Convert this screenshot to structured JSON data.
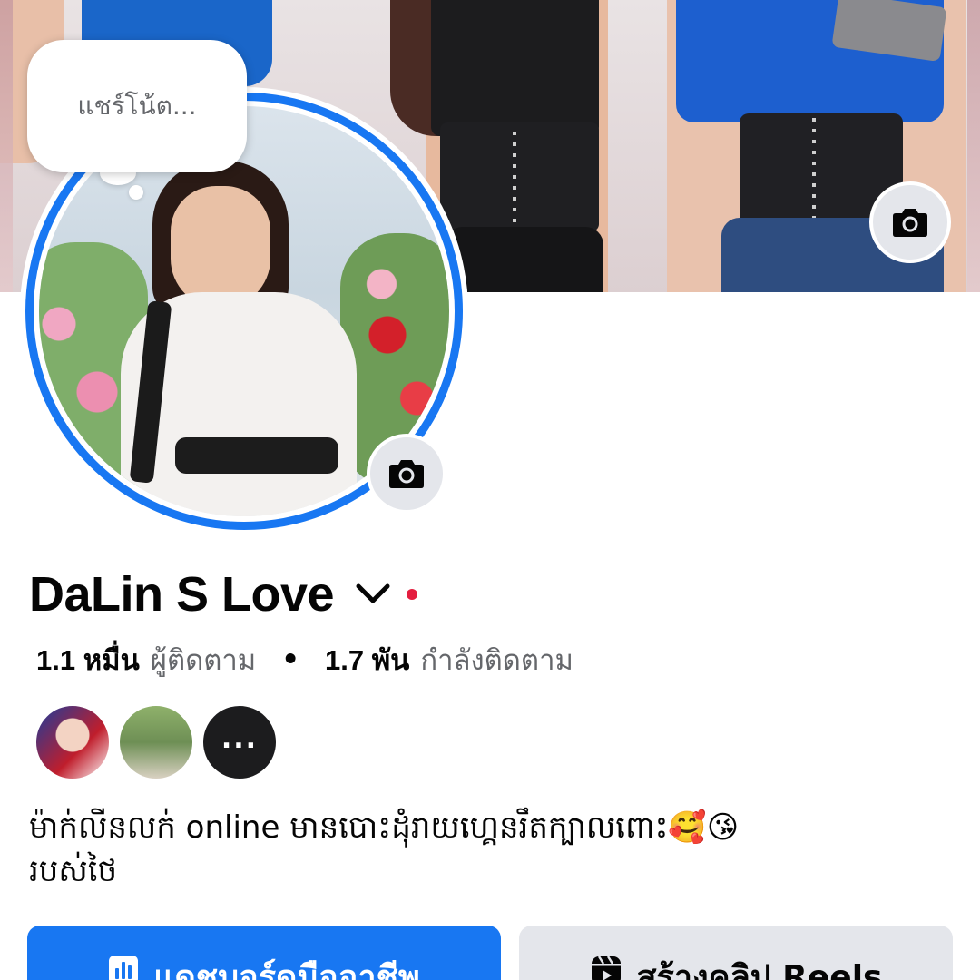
{
  "note": {
    "placeholder": "แชร์โน้ต..."
  },
  "profile": {
    "name": "DaLin S Love"
  },
  "stats": {
    "followers_count": "1.1 หมื่น",
    "followers_label": "ผู้ติดตาม",
    "separator": "•",
    "following_count": "1.7 พัน",
    "following_label": "กำลังติดตาม"
  },
  "friends": {
    "more_label": "..."
  },
  "bio": {
    "text": "ម៉ាក់លីនលក់ online មានបោះដុំរាយហ្គេនរឹតក្បាលពោះ🥰😘\nរបស់ថៃ"
  },
  "buttons": {
    "dashboard_label": "แดชบอร์ดมืออาชีพ",
    "reels_label": "สร้างคลิป Reels"
  },
  "icons": {
    "cover_camera": "camera-icon",
    "avatar_camera": "camera-icon",
    "name_dropdown": "chevron-down-icon",
    "dashboard": "bar-chart-icon",
    "reels": "reels-icon"
  },
  "colors": {
    "accent": "#1877f2",
    "status_dot": "#e41e3f",
    "secondary_button": "#e4e6eb",
    "muted_text": "#65676b"
  }
}
